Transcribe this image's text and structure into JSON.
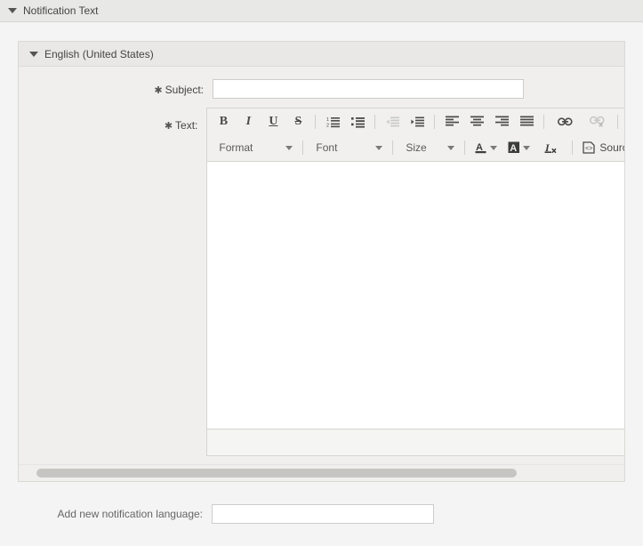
{
  "widget": {
    "title": "Notification Text",
    "collapse_icon": "caret-down-icon"
  },
  "language_panel": {
    "title": "English (United States)",
    "collapse_icon": "caret-down-icon"
  },
  "form": {
    "required_marker": "✱",
    "subject": {
      "label": "Subject:",
      "value": "",
      "placeholder": ""
    },
    "text": {
      "label": "Text:"
    }
  },
  "editor": {
    "toolbar_row1": [
      {
        "name": "bold-icon",
        "glyph": "B",
        "style": "g-b",
        "disabled": false
      },
      {
        "name": "italic-icon",
        "glyph": "I",
        "style": "g-i",
        "disabled": false
      },
      {
        "name": "underline-icon",
        "glyph": "U",
        "style": "g-u",
        "disabled": false
      },
      {
        "name": "strikethrough-icon",
        "glyph": "S",
        "style": "g-s",
        "disabled": false
      },
      {
        "name": "separator",
        "glyph": "",
        "style": "sep",
        "disabled": false
      },
      {
        "name": "numbered-list-icon",
        "glyph": "",
        "style": "svg-ol",
        "disabled": false
      },
      {
        "name": "bulleted-list-icon",
        "glyph": "",
        "style": "svg-ul",
        "disabled": false
      },
      {
        "name": "separator",
        "glyph": "",
        "style": "sep",
        "disabled": false
      },
      {
        "name": "decrease-indent-icon",
        "glyph": "",
        "style": "svg-outdent",
        "disabled": true
      },
      {
        "name": "increase-indent-icon",
        "glyph": "",
        "style": "svg-indent",
        "disabled": false
      },
      {
        "name": "separator",
        "glyph": "",
        "style": "sep",
        "disabled": false
      },
      {
        "name": "align-left-icon",
        "glyph": "",
        "style": "svg-al",
        "disabled": false
      },
      {
        "name": "align-center-icon",
        "glyph": "",
        "style": "svg-ac",
        "disabled": false
      },
      {
        "name": "align-right-icon",
        "glyph": "",
        "style": "svg-ar",
        "disabled": false
      },
      {
        "name": "align-justify-icon",
        "glyph": "",
        "style": "svg-aj",
        "disabled": false
      },
      {
        "name": "separator",
        "glyph": "",
        "style": "sep",
        "disabled": false
      },
      {
        "name": "link-icon",
        "glyph": "",
        "style": "svg-link",
        "disabled": false
      },
      {
        "name": "unlink-icon",
        "glyph": "",
        "style": "svg-unlink",
        "disabled": true
      },
      {
        "name": "separator",
        "glyph": "",
        "style": "sep",
        "disabled": false
      },
      {
        "name": "blockquote-icon",
        "glyph": "",
        "style": "svg-quote",
        "disabled": false
      },
      {
        "name": "separator",
        "glyph": "",
        "style": "sep",
        "disabled": false
      }
    ],
    "combos": [
      {
        "name": "format-dropdown",
        "label": "Format",
        "class": "combo-format"
      },
      {
        "name": "font-dropdown",
        "label": "Font",
        "class": "combo-font"
      },
      {
        "name": "size-dropdown",
        "label": "Size",
        "class": "combo-size"
      }
    ],
    "text_color_label": "A",
    "bg_color_label": "A",
    "remove_format_label": "I",
    "source_label": "Source",
    "body_value": ""
  },
  "scrollbar": {
    "name": "horizontal-scrollbar",
    "thumb_color": "#c6c5c2"
  },
  "footer": {
    "add_language_label": "Add new notification language:",
    "add_language_value": "",
    "add_language_placeholder": ""
  },
  "colors": {
    "page_bg": "#f4f4f4",
    "header_bg": "#e8e8e6",
    "panel_bg": "#f0efed",
    "toolbar_bg": "#f1f0ee",
    "editor_bg": "#ffffff",
    "border": "#d4d4d1",
    "text": "#444444"
  }
}
